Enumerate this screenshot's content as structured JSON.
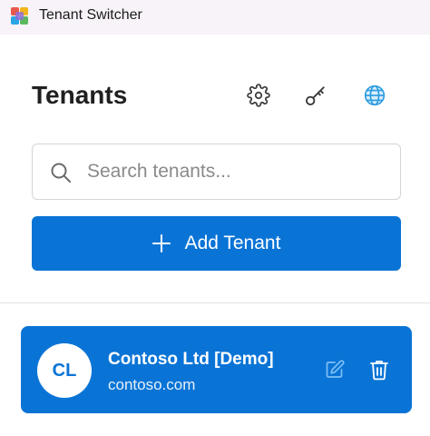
{
  "window": {
    "title": "Tenant Switcher",
    "icon": "app-grid-icon"
  },
  "header": {
    "title": "Tenants",
    "buttons": [
      {
        "icon": "gear-icon"
      },
      {
        "icon": "key-icon"
      },
      {
        "icon": "globe-icon"
      }
    ]
  },
  "search": {
    "placeholder": "Search tenants...",
    "value": "",
    "icon": "search-icon"
  },
  "add_button": {
    "label": "Add Tenant",
    "icon": "plus-icon"
  },
  "tenants": [
    {
      "initials": "CL",
      "name": "Contoso Ltd [Demo]",
      "domain": "contoso.com",
      "selected": true,
      "actions": [
        "edit-icon",
        "trash-icon"
      ]
    }
  ],
  "colors": {
    "accent": "#0a74d6",
    "titlebar": "#f7f3f8"
  }
}
